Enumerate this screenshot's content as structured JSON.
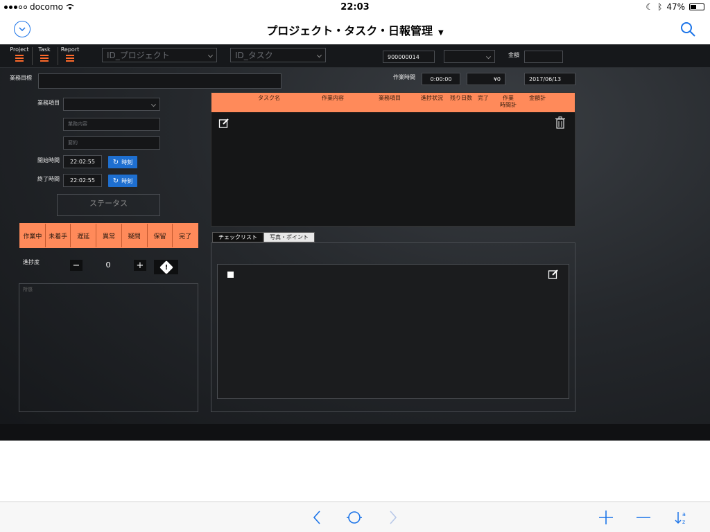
{
  "status_bar": {
    "carrier": "docomo",
    "time": "22:03",
    "battery": "47%",
    "battery_level": 0.47
  },
  "nav": {
    "title": "プロジェクト・タスク・日報管理",
    "title_caret": "▼"
  },
  "top_nav": {
    "project": "Project",
    "task": "Task",
    "report": "Report"
  },
  "top_fields": {
    "project_select_placeholder": "ID_プロジェクト",
    "task_select_placeholder": "ID_タスク",
    "id_value": "900000014",
    "select_value": "",
    "amount_label": "金額",
    "amount_value": ""
  },
  "form": {
    "goal_label": "業務目標",
    "goal_value": "",
    "work_time_label": "作業時間",
    "work_time_value": "0:00:00",
    "money_value": "¥0",
    "date_value": "2017/06/13",
    "item_label": "業務項目",
    "content_placeholder": "業務内容",
    "summary_placeholder": "要約",
    "start_label": "開始時間",
    "start_value": "22:02:55",
    "end_label": "終了時間",
    "end_value": "22:02:55",
    "time_button": "時刻",
    "status_placeholder": "ステータス",
    "progress_label": "進捗度",
    "progress_value": "0",
    "memo_placeholder": "所感"
  },
  "status_buttons": [
    "作業中",
    "未着手",
    "遅延",
    "異常",
    "疑問",
    "保留",
    "完了"
  ],
  "table": {
    "headers": [
      "タスク名",
      "作業内容",
      "業務項目",
      "進捗状況",
      "残り日数",
      "完了",
      "作業\n時間計",
      "金額計"
    ]
  },
  "tabs": [
    "チェックリスト",
    "写真・ポイント"
  ],
  "colors": {
    "accent_orange": "#ff8a5a",
    "ios_blue": "#1a73e8",
    "dark_bg": "#25282c"
  },
  "icons": {
    "nav_left": "chevron-down-circle-icon",
    "nav_right": "search-icon",
    "edit": "edit-icon",
    "trash": "trash-icon",
    "refresh": "refresh-icon",
    "warning": "warning-icon",
    "back": "chevron-left-icon",
    "home": "circle-icon",
    "forward": "chevron-right-icon",
    "add": "plus-icon",
    "remove": "minus-icon",
    "sort": "sort-az-icon"
  }
}
